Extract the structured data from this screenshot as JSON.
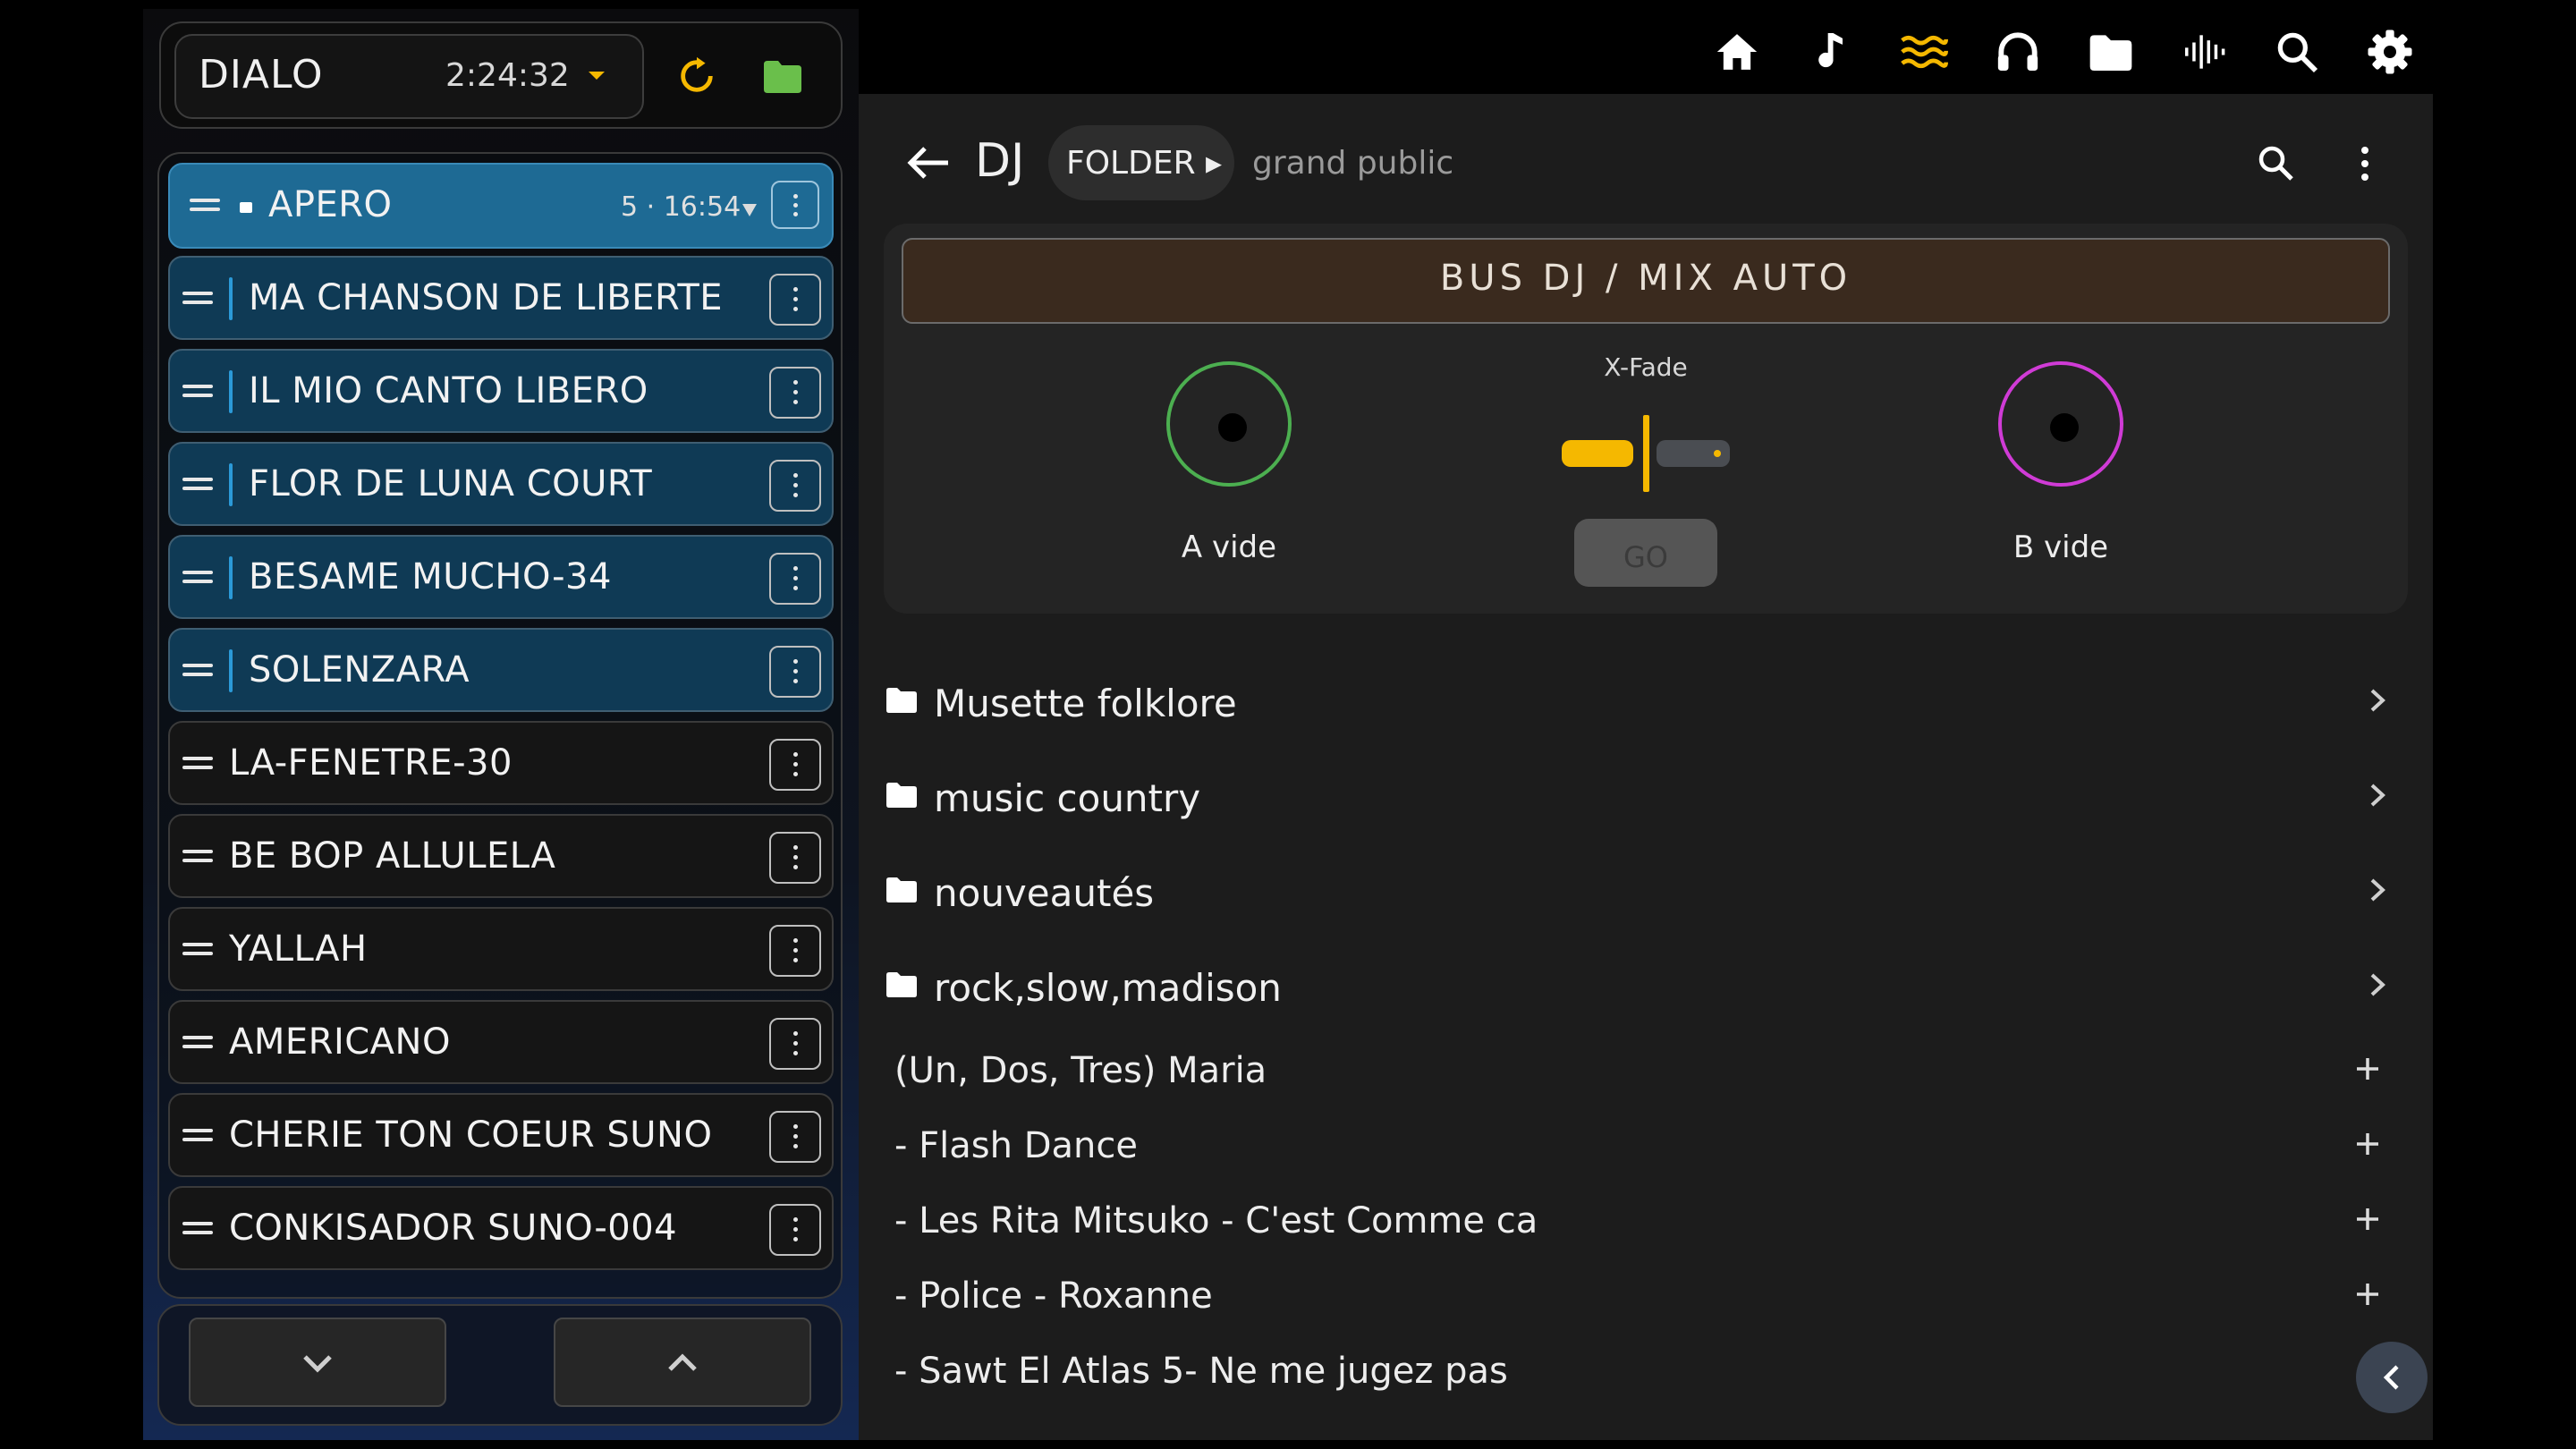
{
  "header": {
    "app_name": "DIALO",
    "clock": "2:24:32"
  },
  "playlist": {
    "group": {
      "name": "APERO",
      "count_duration": "5 · 16:54"
    },
    "items": [
      {
        "title": "MA CHANSON DE LIBERTE",
        "in_group": true
      },
      {
        "title": "IL MIO CANTO LIBERO",
        "in_group": true
      },
      {
        "title": "FLOR DE LUNA COURT",
        "in_group": true
      },
      {
        "title": "BESAME MUCHO-34",
        "in_group": true
      },
      {
        "title": "SOLENZARA",
        "in_group": true
      },
      {
        "title": "LA-FENETRE-30",
        "in_group": false
      },
      {
        "title": "BE BOP ALLULELA",
        "in_group": false
      },
      {
        "title": "YALLAH",
        "in_group": false
      },
      {
        "title": "AMERICANO",
        "in_group": false
      },
      {
        "title": "CHERIE TON COEUR SUNO",
        "in_group": false
      },
      {
        "title": "CONKISADOR SUNO-004",
        "in_group": false
      }
    ]
  },
  "topnav": {
    "icons": [
      "home-icon",
      "music-note-icon",
      "waves-icon",
      "headphones-icon",
      "folder-icon",
      "waveform-icon",
      "search-icon",
      "settings-icon"
    ],
    "active": "waves-icon"
  },
  "dj": {
    "title": "DJ",
    "folder_label": "FOLDER ▸",
    "breadcrumb": "grand public",
    "bus_label": "BUS DJ / MIX AUTO",
    "xfade_label": "X-Fade",
    "go_label": "GO",
    "deck_a_label": "A vide",
    "deck_b_label": "B vide"
  },
  "browser": {
    "folders": [
      "Musette folklore",
      "music country",
      "nouveautés",
      "rock,slow,madison"
    ],
    "tracks": [
      "(Un, Dos, Tres) Maria",
      "- Flash Dance",
      "- Les Rita Mitsuko - C'est Comme ca",
      "- Police - Roxanne",
      "- Sawt El Atlas 5- Ne me jugez pas"
    ]
  },
  "colors": {
    "accent_yellow": "#f5b800",
    "group_blue": "#1e6a94",
    "deck_a": "#4caf50",
    "deck_b": "#d03bd6",
    "folder_green": "#6abf4b"
  }
}
